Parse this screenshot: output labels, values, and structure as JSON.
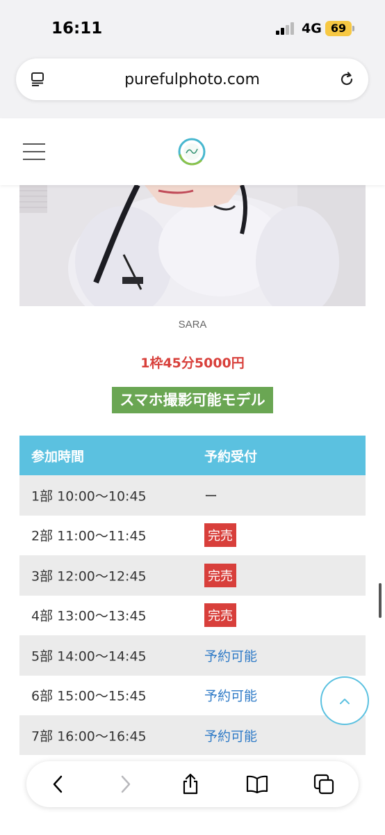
{
  "status_bar": {
    "time": "16:11",
    "network": "4G",
    "battery": "69"
  },
  "browser": {
    "url": "purefulphoto.com"
  },
  "site": {
    "logo_alt": "Pureful"
  },
  "model": {
    "name": "SARA",
    "price": "1枠45分5000円",
    "badge": "スマホ撮影可能モデル"
  },
  "schedule": {
    "headers": {
      "time": "参加時間",
      "status": "予約受付"
    },
    "rows": [
      {
        "time": "1部 10:00〜10:45",
        "status": "ー",
        "type": "none"
      },
      {
        "time": "2部 11:00〜11:45",
        "status": "完売",
        "type": "soldout"
      },
      {
        "time": "3部 12:00〜12:45",
        "status": "完売",
        "type": "soldout"
      },
      {
        "time": "4部 13:00〜13:45",
        "status": "完売",
        "type": "soldout"
      },
      {
        "time": "5部 14:00〜14:45",
        "status": "予約可能",
        "type": "available"
      },
      {
        "time": "6部 15:00〜15:45",
        "status": "予約可能",
        "type": "available"
      },
      {
        "time": "7部 16:00〜16:45",
        "status": "予約可能",
        "type": "available"
      }
    ]
  },
  "colors": {
    "header_blue": "#5bc1e0",
    "soldout_red": "#d83f3b",
    "available_blue": "#2f7bc7",
    "badge_green": "#6aa653",
    "price_red": "#d8403b"
  },
  "icons": [
    "tabs-icon",
    "reload-icon",
    "menu-icon",
    "chevron-up-icon",
    "back-icon",
    "forward-icon",
    "share-icon",
    "bookmarks-icon",
    "tabs-overview-icon"
  ]
}
